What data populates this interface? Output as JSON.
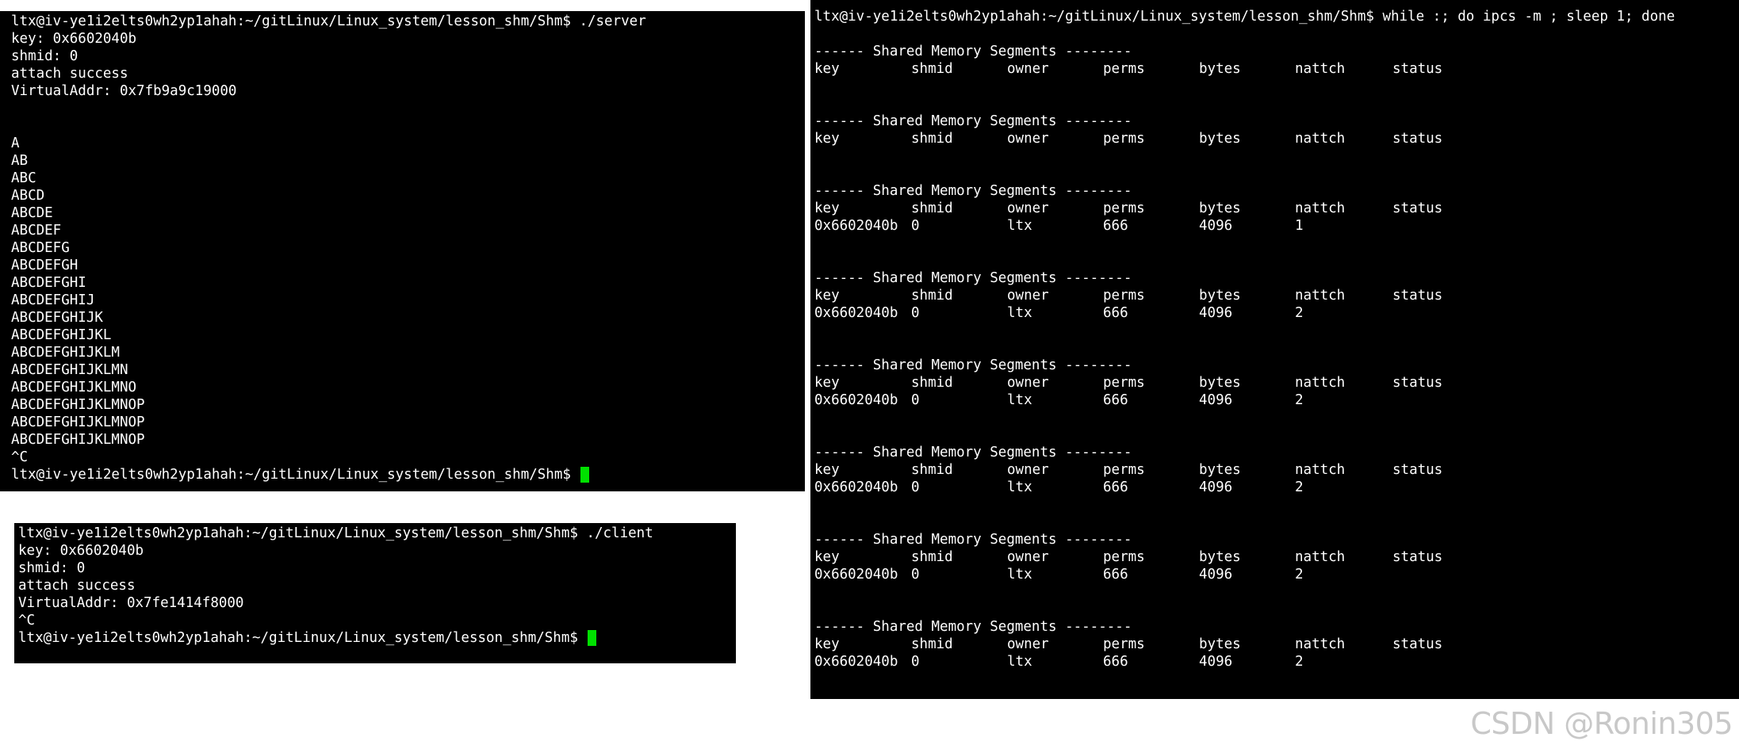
{
  "server": {
    "prompt": "ltx@iv-ye1i2elts0wh2yp1ahah:~/gitLinux/Linux_system/lesson_shm/Shm$ ./server",
    "lines": [
      "key: 0x6602040b",
      "shmid: 0",
      "attach success",
      "VirtualAddr: 0x7fb9a9c19000",
      "",
      "",
      "A",
      "AB",
      "ABC",
      "ABCD",
      "ABCDE",
      "ABCDEF",
      "ABCDEFG",
      "ABCDEFGH",
      "ABCDEFGHI",
      "ABCDEFGHIJ",
      "ABCDEFGHIJK",
      "ABCDEFGHIJKL",
      "ABCDEFGHIJKLM",
      "ABCDEFGHIJKLMN",
      "ABCDEFGHIJKLMNO",
      "ABCDEFGHIJKLMNOP",
      "ABCDEFGHIJKLMNOP",
      "ABCDEFGHIJKLMNOP",
      "^C"
    ],
    "final_prompt": "ltx@iv-ye1i2elts0wh2yp1ahah:~/gitLinux/Linux_system/lesson_shm/Shm$ "
  },
  "client": {
    "prompt": "ltx@iv-ye1i2elts0wh2yp1ahah:~/gitLinux/Linux_system/lesson_shm/Shm$ ./client",
    "lines": [
      "key: 0x6602040b",
      "shmid: 0",
      "attach success",
      "VirtualAddr: 0x7fe1414f8000",
      "^C"
    ],
    "final_prompt": "ltx@iv-ye1i2elts0wh2yp1ahah:~/gitLinux/Linux_system/lesson_shm/Shm$ "
  },
  "ipcs": {
    "prompt": "ltx@iv-ye1i2elts0wh2yp1ahah:~/gitLinux/Linux_system/lesson_shm/Shm$ while :; do ipcs -m ; sleep 1; done",
    "section_header": "------ Shared Memory Segments --------",
    "columns": [
      "key",
      "shmid",
      "owner",
      "perms",
      "bytes",
      "nattch",
      "status"
    ],
    "blocks": [
      {
        "rows": []
      },
      {
        "rows": []
      },
      {
        "rows": [
          [
            "0x6602040b",
            "0",
            "ltx",
            "666",
            "4096",
            "1",
            ""
          ]
        ]
      },
      {
        "rows": [
          [
            "0x6602040b",
            "0",
            "ltx",
            "666",
            "4096",
            "2",
            ""
          ]
        ]
      },
      {
        "rows": [
          [
            "0x6602040b",
            "0",
            "ltx",
            "666",
            "4096",
            "2",
            ""
          ]
        ]
      },
      {
        "rows": [
          [
            "0x6602040b",
            "0",
            "ltx",
            "666",
            "4096",
            "2",
            ""
          ]
        ]
      },
      {
        "rows": [
          [
            "0x6602040b",
            "0",
            "ltx",
            "666",
            "4096",
            "2",
            ""
          ]
        ]
      },
      {
        "rows": [
          [
            "0x6602040b",
            "0",
            "ltx",
            "666",
            "4096",
            "2",
            ""
          ]
        ]
      }
    ]
  },
  "watermark": "CSDN @Ronin305",
  "colors": {
    "terminal_bg": "#000000",
    "terminal_fg": "#ffffff",
    "cursor": "#00e000",
    "watermark": "#c8c8c8"
  }
}
